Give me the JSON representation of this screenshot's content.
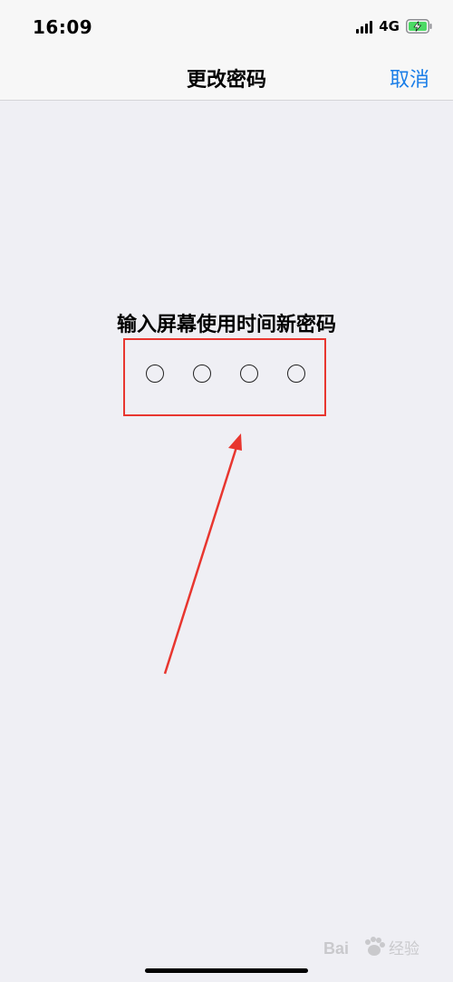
{
  "status_bar": {
    "time": "16:09",
    "network": "4G",
    "icons": [
      "signal-icon",
      "battery-charging-icon"
    ]
  },
  "nav": {
    "title": "更改密码",
    "cancel_label": "取消"
  },
  "passcode": {
    "prompt": "输入屏幕使用时间新密码",
    "digit_count": 4,
    "filled_count": 0
  },
  "annotation": {
    "highlight_color": "#e8362f",
    "arrow_color": "#e8362f"
  },
  "watermark": {
    "icon": "baidu-paw-icon",
    "text": "Bai 经验"
  },
  "colors": {
    "background": "#efeff4",
    "bar": "#f7f7f7",
    "accent": "#1a7ee8"
  }
}
